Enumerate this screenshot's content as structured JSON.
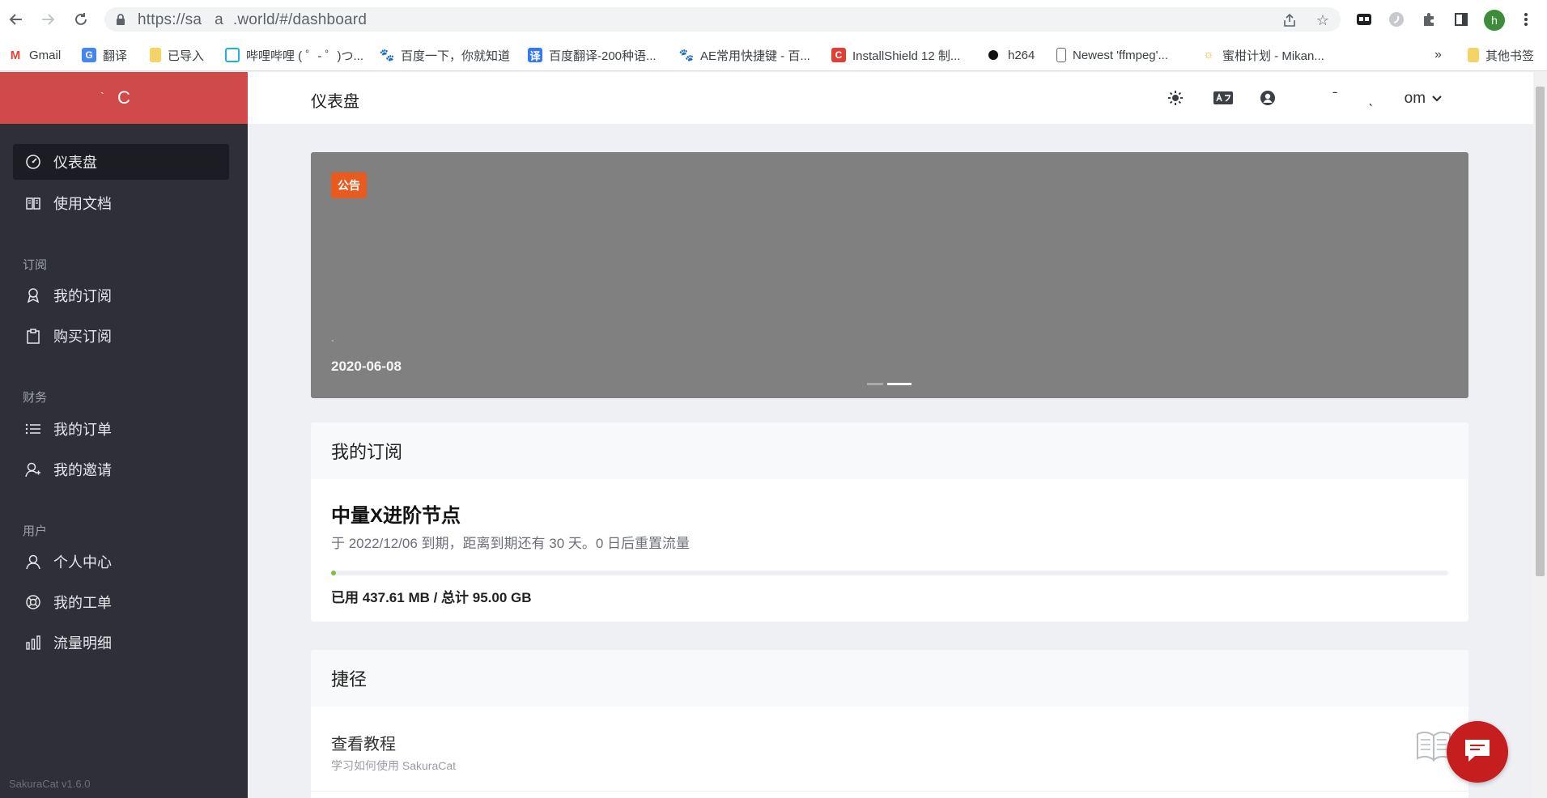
{
  "browser": {
    "url": "https://sa    a   .world/#/dashboard",
    "profile_initial": "h",
    "bookmarks": [
      {
        "label": "Gmail",
        "icon": "gmail-icon",
        "color": "#ea4335",
        "glyph": "M"
      },
      {
        "label": "翻译",
        "icon": "translate-icon",
        "color": "#4285f4",
        "glyph": "G"
      },
      {
        "label": "已导入",
        "icon": "folder-icon",
        "color": "#f6d365",
        "glyph": ""
      },
      {
        "label": "哔哩哔哩 ( ゜- ゜)つ...",
        "icon": "bilibili-icon",
        "color": "#23ade5",
        "glyph": "b"
      },
      {
        "label": "百度一下，你就知道",
        "icon": "baidu-icon",
        "color": "#2932e1",
        "glyph": "du"
      },
      {
        "label": "百度翻译-200种语...",
        "icon": "baidu-translate-icon",
        "color": "#3478f6",
        "glyph": "译"
      },
      {
        "label": "AE常用快捷键 - 百...",
        "icon": "baidu-icon",
        "color": "#2932e1",
        "glyph": "du"
      },
      {
        "label": "InstallShield 12 制...",
        "icon": "csdn-icon",
        "color": "#e33e33",
        "glyph": "C"
      },
      {
        "label": "h264",
        "icon": "dot-icon",
        "color": "#111111",
        "glyph": ""
      },
      {
        "label": "Newest 'ffmpeg'...",
        "icon": "stackoverflow-icon",
        "color": "#ffffff",
        "glyph": "["
      },
      {
        "label": "蜜柑计划 - Mikan...",
        "icon": "mikan-icon",
        "color": "#f5c542",
        "glyph": "☼"
      },
      {
        "label": "其他书签",
        "icon": "folder-icon",
        "color": "#f6d365",
        "glyph": ""
      }
    ],
    "overflow_label": "»"
  },
  "sidebar": {
    "brand_text": "C",
    "brand_mark": "`",
    "items": [
      {
        "label": "仪表盘",
        "icon": "dashboard-icon",
        "active": true
      },
      {
        "label": "使用文档",
        "icon": "book-icon",
        "active": false
      }
    ],
    "sections": [
      {
        "heading": "订阅",
        "items": [
          {
            "label": "我的订阅",
            "icon": "subscription-icon"
          },
          {
            "label": "购买订阅",
            "icon": "clipboard-icon"
          }
        ]
      },
      {
        "heading": "财务",
        "items": [
          {
            "label": "我的订单",
            "icon": "list-icon"
          },
          {
            "label": "我的邀请",
            "icon": "invite-icon"
          }
        ]
      },
      {
        "heading": "用户",
        "items": [
          {
            "label": "个人中心",
            "icon": "user-icon"
          },
          {
            "label": "我的工单",
            "icon": "support-icon"
          },
          {
            "label": "流量明细",
            "icon": "bar-chart-icon"
          }
        ]
      }
    ],
    "version": "SakuraCat v1.6.0"
  },
  "header": {
    "title": "仪表盘",
    "user_label": "ˉ  ˎ  om"
  },
  "announcement": {
    "badge": "公告",
    "mark": "`",
    "date": "2020-06-08",
    "slides": 2,
    "active_slide": 2
  },
  "subscription": {
    "heading": "我的订阅",
    "plan_name": "中量X进阶节点",
    "expire_text": "于 2022/12/06 到期，距离到期还有 30 天。0 日后重置流量",
    "used_fraction": 0.0046,
    "usage_text": "已用 437.61 MB / 总计 95.00 GB"
  },
  "shortcuts": {
    "heading": "捷径",
    "items": [
      {
        "title": "查看教程",
        "subtitle": "学习如何使用 SakuraCat",
        "icon": "open-book-icon"
      }
    ]
  },
  "colors": {
    "brand": "#d04a4a",
    "sidebar_bg": "#2f3037",
    "badge": "#e85a1e",
    "progress": "#7bc043",
    "chat": "#c61e1e"
  }
}
